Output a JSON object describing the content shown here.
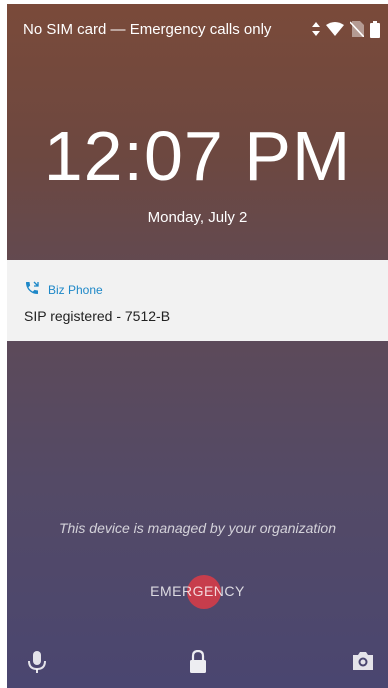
{
  "status_bar": {
    "carrier_text": "No SIM card — Emergency calls only",
    "icons": [
      "data-arrows-icon",
      "wifi-icon",
      "no-sim-icon",
      "battery-icon"
    ]
  },
  "lock_screen": {
    "time": "12:07 PM",
    "date": "Monday, July 2"
  },
  "notification": {
    "app_name": "Biz Phone",
    "app_icon": "phone-callback-icon",
    "message": "SIP registered - 7512-B",
    "accent_color": "#1e88c8"
  },
  "managed_text": "This device is managed by your organization",
  "emergency_label": "EMERGENCY",
  "bottom_shortcuts": {
    "left": "microphone-icon",
    "center": "lock-icon",
    "right": "camera-icon"
  }
}
